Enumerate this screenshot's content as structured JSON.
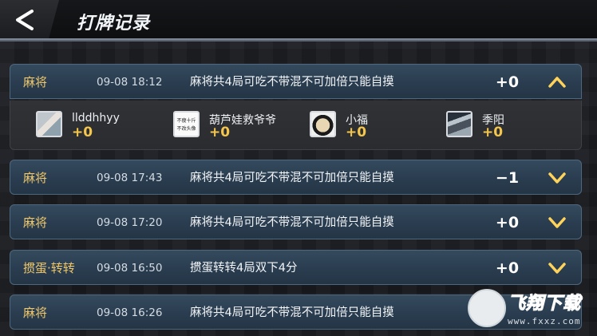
{
  "header": {
    "title": "打牌记录"
  },
  "records": [
    {
      "type": "麻将",
      "time": "09-08 18:12",
      "rule": "麻将共4局可吃不带混不可加倍只能自摸",
      "score": "+0",
      "expanded": true
    },
    {
      "type": "麻将",
      "time": "09-08 17:43",
      "rule": "麻将共4局可吃不带混不可加倍只能自摸",
      "score": "−1",
      "expanded": false
    },
    {
      "type": "麻将",
      "time": "09-08 17:20",
      "rule": "麻将共4局可吃不带混不可加倍只能自摸",
      "score": "+0",
      "expanded": false
    },
    {
      "type": "掼蛋·转转",
      "time": "09-08 16:50",
      "rule": "掼蛋转转4局双下4分",
      "score": "+0",
      "expanded": false
    },
    {
      "type": "麻将",
      "time": "09-08 16:26",
      "rule": "麻将共4局可吃不带混不可加倍只能自摸",
      "score": "",
      "expanded": false
    }
  ],
  "players": [
    {
      "name": "llddhhyy",
      "score": "+0",
      "avatar": "photo-avatar"
    },
    {
      "name": "葫芦娃救爷爷",
      "score": "+0",
      "avatar": "text-avatar",
      "avatar_text": [
        "不瘦十斤",
        "不改头像"
      ]
    },
    {
      "name": "小福",
      "score": "+0",
      "avatar": "anime-avatar"
    },
    {
      "name": "季阳",
      "score": "+0",
      "avatar": "figure-avatar"
    }
  ],
  "watermark": {
    "brand": "飞翔下载",
    "url": "www.fxxz.com"
  },
  "colors": {
    "accent_gold": "#f0c86a",
    "score_gold": "#f4c64c",
    "row_blue": "#2a3d50"
  }
}
